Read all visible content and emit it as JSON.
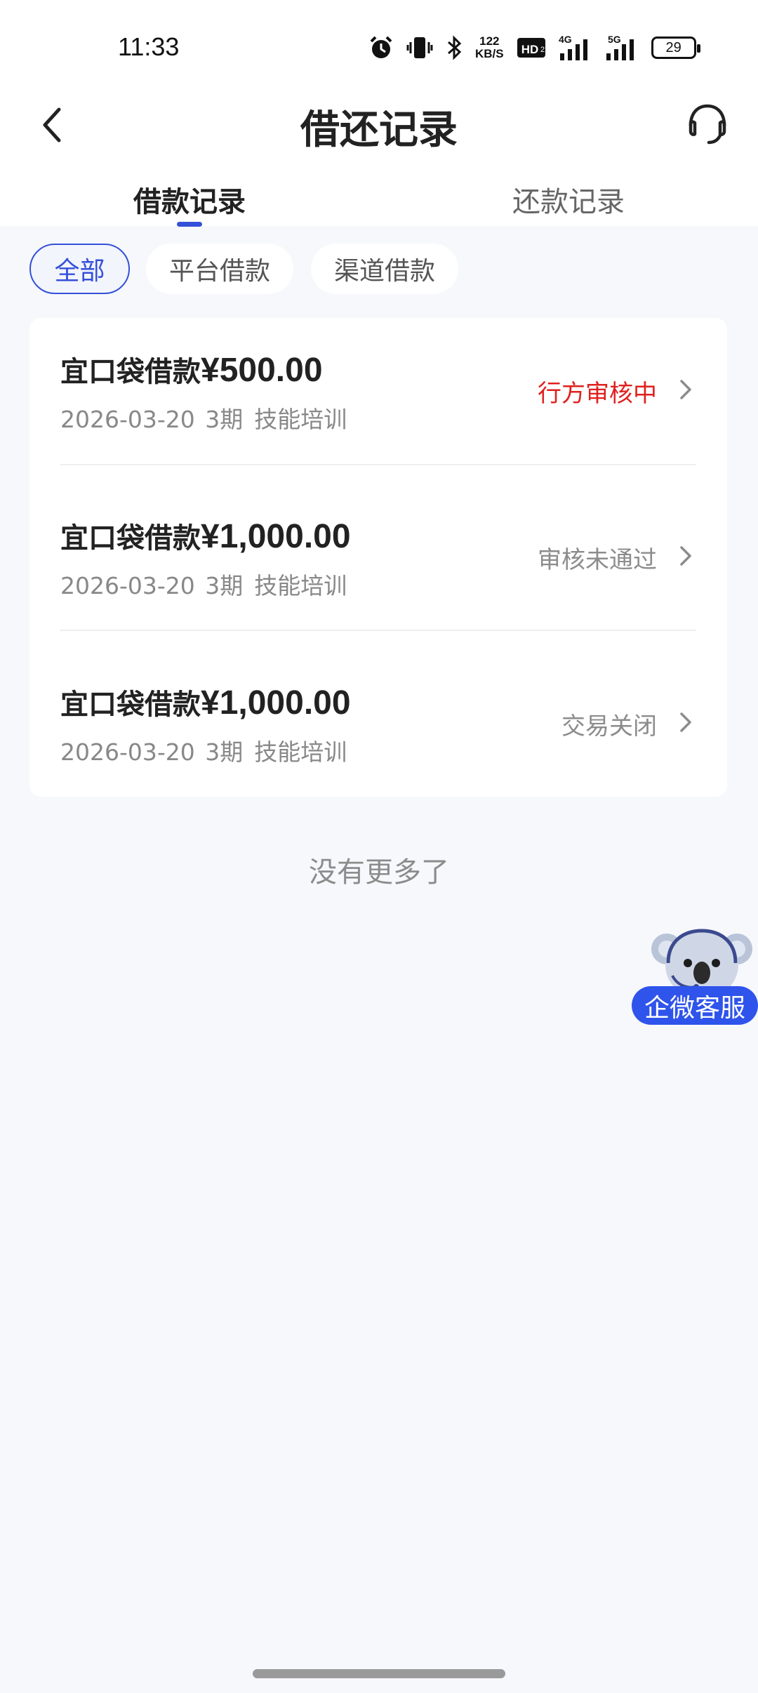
{
  "status_bar": {
    "time": "11:33",
    "net_speed_value": "122",
    "net_speed_unit": "KB/S",
    "hd_label": "HD",
    "net1_label": "4G",
    "net2_label": "5G",
    "battery": "29"
  },
  "header": {
    "title": "借还记录",
    "back_icon": "chevron-left-icon",
    "support_icon": "headset-icon"
  },
  "tabs": [
    {
      "label": "借款记录",
      "active": true
    },
    {
      "label": "还款记录",
      "active": false
    }
  ],
  "filters": [
    {
      "label": "全部",
      "selected": true
    },
    {
      "label": "平台借款",
      "selected": false
    },
    {
      "label": "渠道借款",
      "selected": false
    }
  ],
  "records": [
    {
      "title": "宜口袋借款",
      "amount": "¥500.00",
      "date": "2026-03-20",
      "term": "3期",
      "purpose": "技能培训",
      "status": "行方审核中",
      "status_color": "#e0201f"
    },
    {
      "title": "宜口袋借款",
      "amount": "¥1,000.00",
      "date": "2026-03-20",
      "term": "3期",
      "purpose": "技能培训",
      "status": "审核未通过",
      "status_color": "#8c8c8c"
    },
    {
      "title": "宜口袋借款",
      "amount": "¥1,000.00",
      "date": "2026-03-20",
      "term": "3期",
      "purpose": "技能培训",
      "status": "交易关闭",
      "status_color": "#8c8c8c"
    }
  ],
  "footer_text": "没有更多了",
  "floating_support": {
    "label": "企微客服",
    "icon": "koala-mascot-icon"
  },
  "colors": {
    "accent": "#3450d8",
    "pending": "#e0201f",
    "muted": "#8c8c8c",
    "float_button": "#2f54eb"
  }
}
